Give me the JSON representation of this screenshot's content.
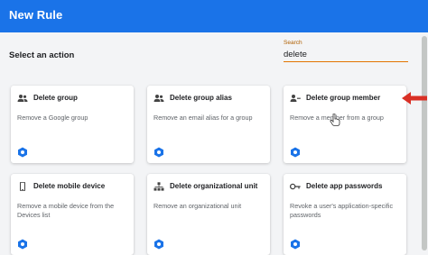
{
  "window": {
    "title": "New Rule"
  },
  "toolbar": {
    "select_label": "Select an action"
  },
  "search": {
    "label": "Search",
    "value": "delete"
  },
  "cards": [
    {
      "id": "delete-group",
      "icon": "group-icon",
      "title": "Delete group",
      "description": "Remove a Google group"
    },
    {
      "id": "delete-group-alias",
      "icon": "group-icon",
      "title": "Delete group alias",
      "description": "Remove an email alias for a group"
    },
    {
      "id": "delete-group-member",
      "icon": "group-member-icon",
      "title": "Delete group member",
      "description": "Remove a member from a group"
    },
    {
      "id": "delete-mobile-device",
      "icon": "mobile-device-icon",
      "title": "Delete mobile device",
      "description": "Remove a mobile device from the Devices list"
    },
    {
      "id": "delete-organizational-unit",
      "icon": "org-unit-icon",
      "title": "Delete organizational unit",
      "description": "Remove an organizational unit"
    },
    {
      "id": "delete-app-passwords",
      "icon": "key-icon",
      "title": "Delete app passwords",
      "description": "Revoke a user's application-specific passwords"
    }
  ],
  "colors": {
    "header": "#1a73e8",
    "accent": "#e37400",
    "annotation_arrow": "#d93025",
    "logo_blue": "#1a73e8"
  }
}
